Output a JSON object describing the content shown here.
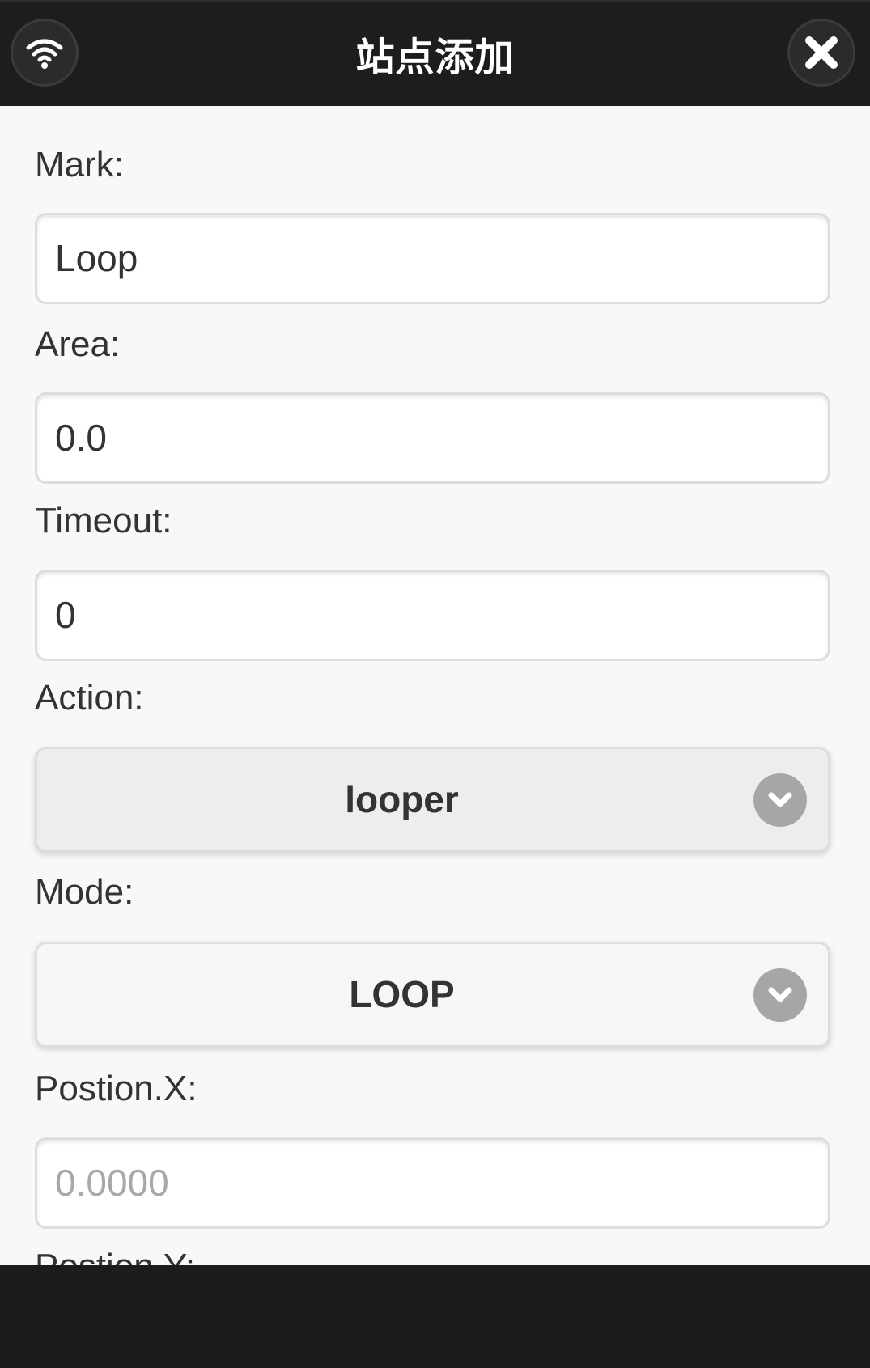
{
  "header": {
    "title": "站点添加",
    "left_icon": "wifi-icon",
    "right_icon": "close-icon"
  },
  "form": {
    "mark": {
      "label": "Mark:",
      "value": "Loop"
    },
    "area": {
      "label": "Area:",
      "value": "0.0"
    },
    "timeout": {
      "label": "Timeout:",
      "value": "0"
    },
    "action": {
      "label": "Action:",
      "selected": "looper"
    },
    "mode": {
      "label": "Mode:",
      "selected": "LOOP"
    },
    "position_x": {
      "label": "Postion.X:",
      "placeholder": "0.0000"
    },
    "position_y": {
      "label": "Postion.Y:"
    }
  },
  "colors": {
    "header_bg": "#1d1d1d",
    "content_bg": "#f8f8f8",
    "chevron": "#a6a6a6"
  }
}
